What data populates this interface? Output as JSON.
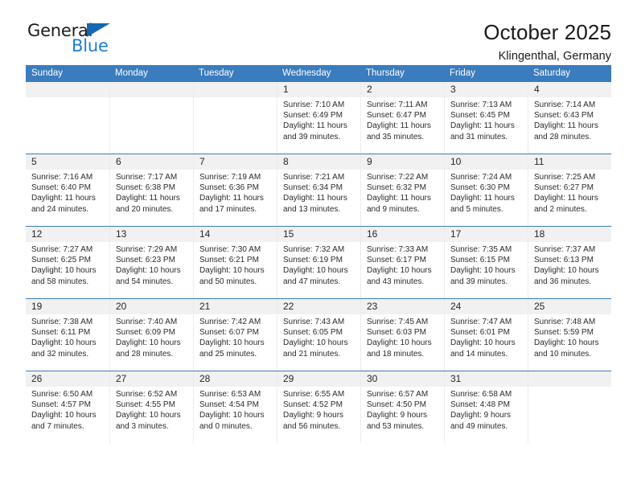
{
  "brand": {
    "line1": "General",
    "line2": "Blue",
    "triangle_icon": "triangle-icon",
    "color_dark": "#1c1c1c",
    "color_blue": "#1c7fd4"
  },
  "header": {
    "title": "October 2025",
    "subtitle": "Klingenthal, Germany"
  },
  "colors": {
    "header_blue": "#3a7cbe",
    "row_divider": "#3a7cbe",
    "daynum_bg": "#f1f1f1",
    "cell_bg": "#ffffff"
  },
  "calendar": {
    "weekdays": [
      "Sunday",
      "Monday",
      "Tuesday",
      "Wednesday",
      "Thursday",
      "Friday",
      "Saturday"
    ],
    "weeks": [
      [
        {
          "day": "",
          "empty": true
        },
        {
          "day": "",
          "empty": true
        },
        {
          "day": "",
          "empty": true
        },
        {
          "day": "1",
          "sunrise": "Sunrise: 7:10 AM",
          "sunset": "Sunset: 6:49 PM",
          "daylight": "Daylight: 11 hours and 39 minutes."
        },
        {
          "day": "2",
          "sunrise": "Sunrise: 7:11 AM",
          "sunset": "Sunset: 6:47 PM",
          "daylight": "Daylight: 11 hours and 35 minutes."
        },
        {
          "day": "3",
          "sunrise": "Sunrise: 7:13 AM",
          "sunset": "Sunset: 6:45 PM",
          "daylight": "Daylight: 11 hours and 31 minutes."
        },
        {
          "day": "4",
          "sunrise": "Sunrise: 7:14 AM",
          "sunset": "Sunset: 6:43 PM",
          "daylight": "Daylight: 11 hours and 28 minutes."
        }
      ],
      [
        {
          "day": "5",
          "sunrise": "Sunrise: 7:16 AM",
          "sunset": "Sunset: 6:40 PM",
          "daylight": "Daylight: 11 hours and 24 minutes."
        },
        {
          "day": "6",
          "sunrise": "Sunrise: 7:17 AM",
          "sunset": "Sunset: 6:38 PM",
          "daylight": "Daylight: 11 hours and 20 minutes."
        },
        {
          "day": "7",
          "sunrise": "Sunrise: 7:19 AM",
          "sunset": "Sunset: 6:36 PM",
          "daylight": "Daylight: 11 hours and 17 minutes."
        },
        {
          "day": "8",
          "sunrise": "Sunrise: 7:21 AM",
          "sunset": "Sunset: 6:34 PM",
          "daylight": "Daylight: 11 hours and 13 minutes."
        },
        {
          "day": "9",
          "sunrise": "Sunrise: 7:22 AM",
          "sunset": "Sunset: 6:32 PM",
          "daylight": "Daylight: 11 hours and 9 minutes."
        },
        {
          "day": "10",
          "sunrise": "Sunrise: 7:24 AM",
          "sunset": "Sunset: 6:30 PM",
          "daylight": "Daylight: 11 hours and 5 minutes."
        },
        {
          "day": "11",
          "sunrise": "Sunrise: 7:25 AM",
          "sunset": "Sunset: 6:27 PM",
          "daylight": "Daylight: 11 hours and 2 minutes."
        }
      ],
      [
        {
          "day": "12",
          "sunrise": "Sunrise: 7:27 AM",
          "sunset": "Sunset: 6:25 PM",
          "daylight": "Daylight: 10 hours and 58 minutes."
        },
        {
          "day": "13",
          "sunrise": "Sunrise: 7:29 AM",
          "sunset": "Sunset: 6:23 PM",
          "daylight": "Daylight: 10 hours and 54 minutes."
        },
        {
          "day": "14",
          "sunrise": "Sunrise: 7:30 AM",
          "sunset": "Sunset: 6:21 PM",
          "daylight": "Daylight: 10 hours and 50 minutes."
        },
        {
          "day": "15",
          "sunrise": "Sunrise: 7:32 AM",
          "sunset": "Sunset: 6:19 PM",
          "daylight": "Daylight: 10 hours and 47 minutes."
        },
        {
          "day": "16",
          "sunrise": "Sunrise: 7:33 AM",
          "sunset": "Sunset: 6:17 PM",
          "daylight": "Daylight: 10 hours and 43 minutes."
        },
        {
          "day": "17",
          "sunrise": "Sunrise: 7:35 AM",
          "sunset": "Sunset: 6:15 PM",
          "daylight": "Daylight: 10 hours and 39 minutes."
        },
        {
          "day": "18",
          "sunrise": "Sunrise: 7:37 AM",
          "sunset": "Sunset: 6:13 PM",
          "daylight": "Daylight: 10 hours and 36 minutes."
        }
      ],
      [
        {
          "day": "19",
          "sunrise": "Sunrise: 7:38 AM",
          "sunset": "Sunset: 6:11 PM",
          "daylight": "Daylight: 10 hours and 32 minutes."
        },
        {
          "day": "20",
          "sunrise": "Sunrise: 7:40 AM",
          "sunset": "Sunset: 6:09 PM",
          "daylight": "Daylight: 10 hours and 28 minutes."
        },
        {
          "day": "21",
          "sunrise": "Sunrise: 7:42 AM",
          "sunset": "Sunset: 6:07 PM",
          "daylight": "Daylight: 10 hours and 25 minutes."
        },
        {
          "day": "22",
          "sunrise": "Sunrise: 7:43 AM",
          "sunset": "Sunset: 6:05 PM",
          "daylight": "Daylight: 10 hours and 21 minutes."
        },
        {
          "day": "23",
          "sunrise": "Sunrise: 7:45 AM",
          "sunset": "Sunset: 6:03 PM",
          "daylight": "Daylight: 10 hours and 18 minutes."
        },
        {
          "day": "24",
          "sunrise": "Sunrise: 7:47 AM",
          "sunset": "Sunset: 6:01 PM",
          "daylight": "Daylight: 10 hours and 14 minutes."
        },
        {
          "day": "25",
          "sunrise": "Sunrise: 7:48 AM",
          "sunset": "Sunset: 5:59 PM",
          "daylight": "Daylight: 10 hours and 10 minutes."
        }
      ],
      [
        {
          "day": "26",
          "sunrise": "Sunrise: 6:50 AM",
          "sunset": "Sunset: 4:57 PM",
          "daylight": "Daylight: 10 hours and 7 minutes."
        },
        {
          "day": "27",
          "sunrise": "Sunrise: 6:52 AM",
          "sunset": "Sunset: 4:55 PM",
          "daylight": "Daylight: 10 hours and 3 minutes."
        },
        {
          "day": "28",
          "sunrise": "Sunrise: 6:53 AM",
          "sunset": "Sunset: 4:54 PM",
          "daylight": "Daylight: 10 hours and 0 minutes."
        },
        {
          "day": "29",
          "sunrise": "Sunrise: 6:55 AM",
          "sunset": "Sunset: 4:52 PM",
          "daylight": "Daylight: 9 hours and 56 minutes."
        },
        {
          "day": "30",
          "sunrise": "Sunrise: 6:57 AM",
          "sunset": "Sunset: 4:50 PM",
          "daylight": "Daylight: 9 hours and 53 minutes."
        },
        {
          "day": "31",
          "sunrise": "Sunrise: 6:58 AM",
          "sunset": "Sunset: 4:48 PM",
          "daylight": "Daylight: 9 hours and 49 minutes."
        },
        {
          "day": "",
          "empty": true
        }
      ]
    ]
  }
}
